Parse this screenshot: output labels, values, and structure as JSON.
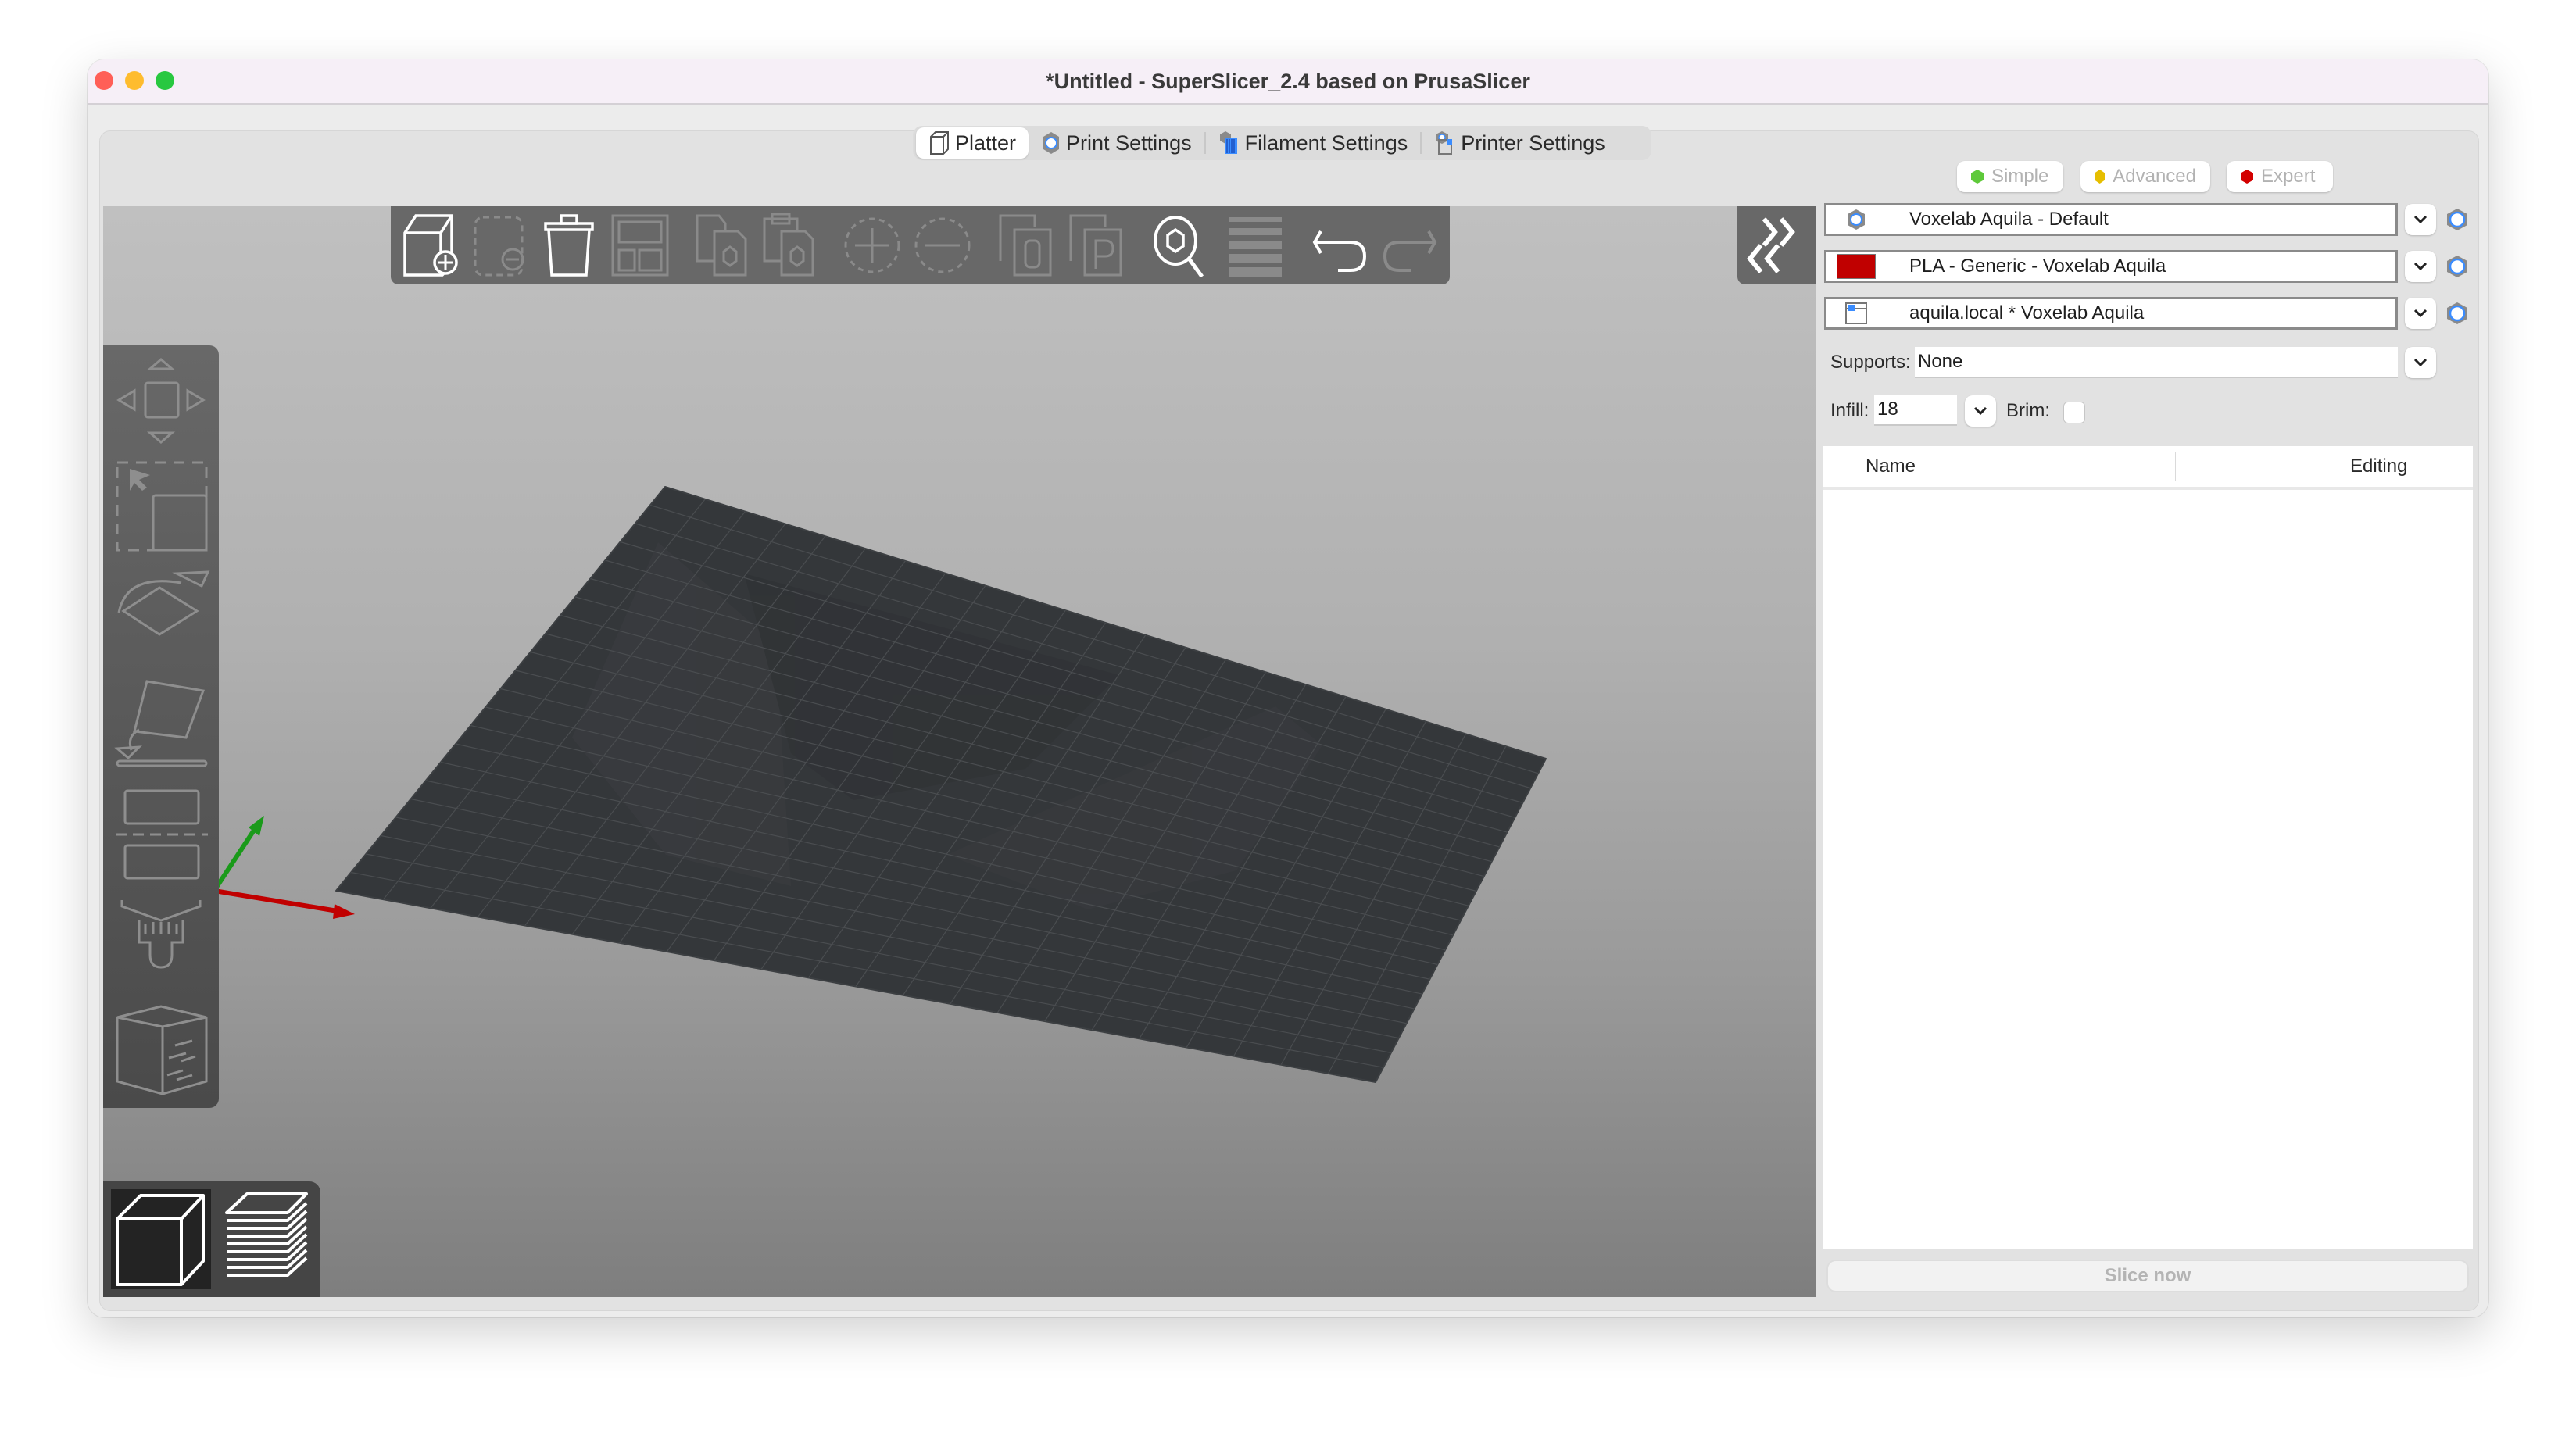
{
  "window": {
    "title": "*Untitled - SuperSlicer_2.4  based on PrusaSlicer",
    "traffic_lights": [
      {
        "name": "close",
        "color": "#ff5f57"
      },
      {
        "name": "minimize",
        "color": "#febc2e"
      },
      {
        "name": "zoom",
        "color": "#28c840"
      }
    ]
  },
  "tabs": [
    {
      "label": "Platter",
      "icon": "platter-cube-icon",
      "active": true
    },
    {
      "label": "Print Settings",
      "icon": "print-settings-gear-icon",
      "active": false
    },
    {
      "label": "Filament Settings",
      "icon": "filament-spool-icon",
      "active": false
    },
    {
      "label": "Printer Settings",
      "icon": "printer-settings-icon",
      "active": false
    }
  ],
  "toolbar": {
    "items": [
      {
        "name": "add-object",
        "icon": "add-box-icon",
        "enabled": true
      },
      {
        "name": "delete",
        "icon": "delete-object-icon",
        "enabled": false
      },
      {
        "name": "delete-all",
        "icon": "trash-icon",
        "enabled": true
      },
      {
        "name": "arrange",
        "icon": "arrange-icon",
        "enabled": false
      },
      {
        "name": "copy",
        "icon": "copy-icon",
        "enabled": false
      },
      {
        "name": "paste",
        "icon": "paste-icon",
        "enabled": false
      },
      {
        "name": "add-instance",
        "icon": "add-instance-icon",
        "enabled": false
      },
      {
        "name": "remove-instance",
        "icon": "remove-instance-icon",
        "enabled": false
      },
      {
        "name": "split-to-objects",
        "icon": "split-objects-icon",
        "enabled": false
      },
      {
        "name": "split-to-parts",
        "icon": "split-parts-icon",
        "enabled": false
      },
      {
        "name": "search",
        "icon": "search-icon",
        "enabled": true
      },
      {
        "name": "layers-editing",
        "icon": "layers-icon",
        "enabled": false
      },
      {
        "name": "undo",
        "icon": "undo-icon",
        "enabled": true
      },
      {
        "name": "redo",
        "icon": "redo-icon",
        "enabled": false
      }
    ]
  },
  "gizmos": [
    {
      "name": "move",
      "icon": "move-icon"
    },
    {
      "name": "scale",
      "icon": "scale-icon"
    },
    {
      "name": "rotate",
      "icon": "rotate-icon"
    },
    {
      "name": "place-on-face",
      "icon": "place-on-face-icon"
    },
    {
      "name": "cut",
      "icon": "cut-icon"
    },
    {
      "name": "paint-supports",
      "icon": "paint-supports-icon"
    },
    {
      "name": "seam-painting",
      "icon": "seam-paint-icon"
    }
  ],
  "view_toggle": [
    {
      "name": "3d-view",
      "icon": "cube-3d-icon",
      "active": true
    },
    {
      "name": "preview",
      "icon": "layers-preview-icon",
      "active": false
    }
  ],
  "mode": {
    "options": [
      {
        "label": "Simple",
        "color": "#5ec93a"
      },
      {
        "label": "Advanced",
        "color": "#e6be00"
      },
      {
        "label": "Expert",
        "color": "#d30000"
      }
    ]
  },
  "presets": {
    "print": {
      "value": "Voxelab Aquila - Default",
      "icon": "gear-icon"
    },
    "filament": {
      "value": "PLA - Generic - Voxelab Aquila",
      "swatch_color": "#c00000"
    },
    "printer": {
      "value": "aquila.local * Voxelab Aquila",
      "icon": "printer-icon"
    }
  },
  "quick_settings": {
    "supports_label": "Supports:",
    "supports_value": "None",
    "infill_label": "Infill:",
    "infill_value": "18",
    "brim_label": "Brim:",
    "brim_checked": false
  },
  "object_list": {
    "columns": [
      "Name",
      "",
      "Editing"
    ],
    "rows": []
  },
  "slice_button": "Slice now",
  "scene": {
    "bed_color": "#34373a",
    "axes": {
      "x": "#c00000",
      "y": "#1a9a1a",
      "z": "#0a0a8a"
    }
  }
}
